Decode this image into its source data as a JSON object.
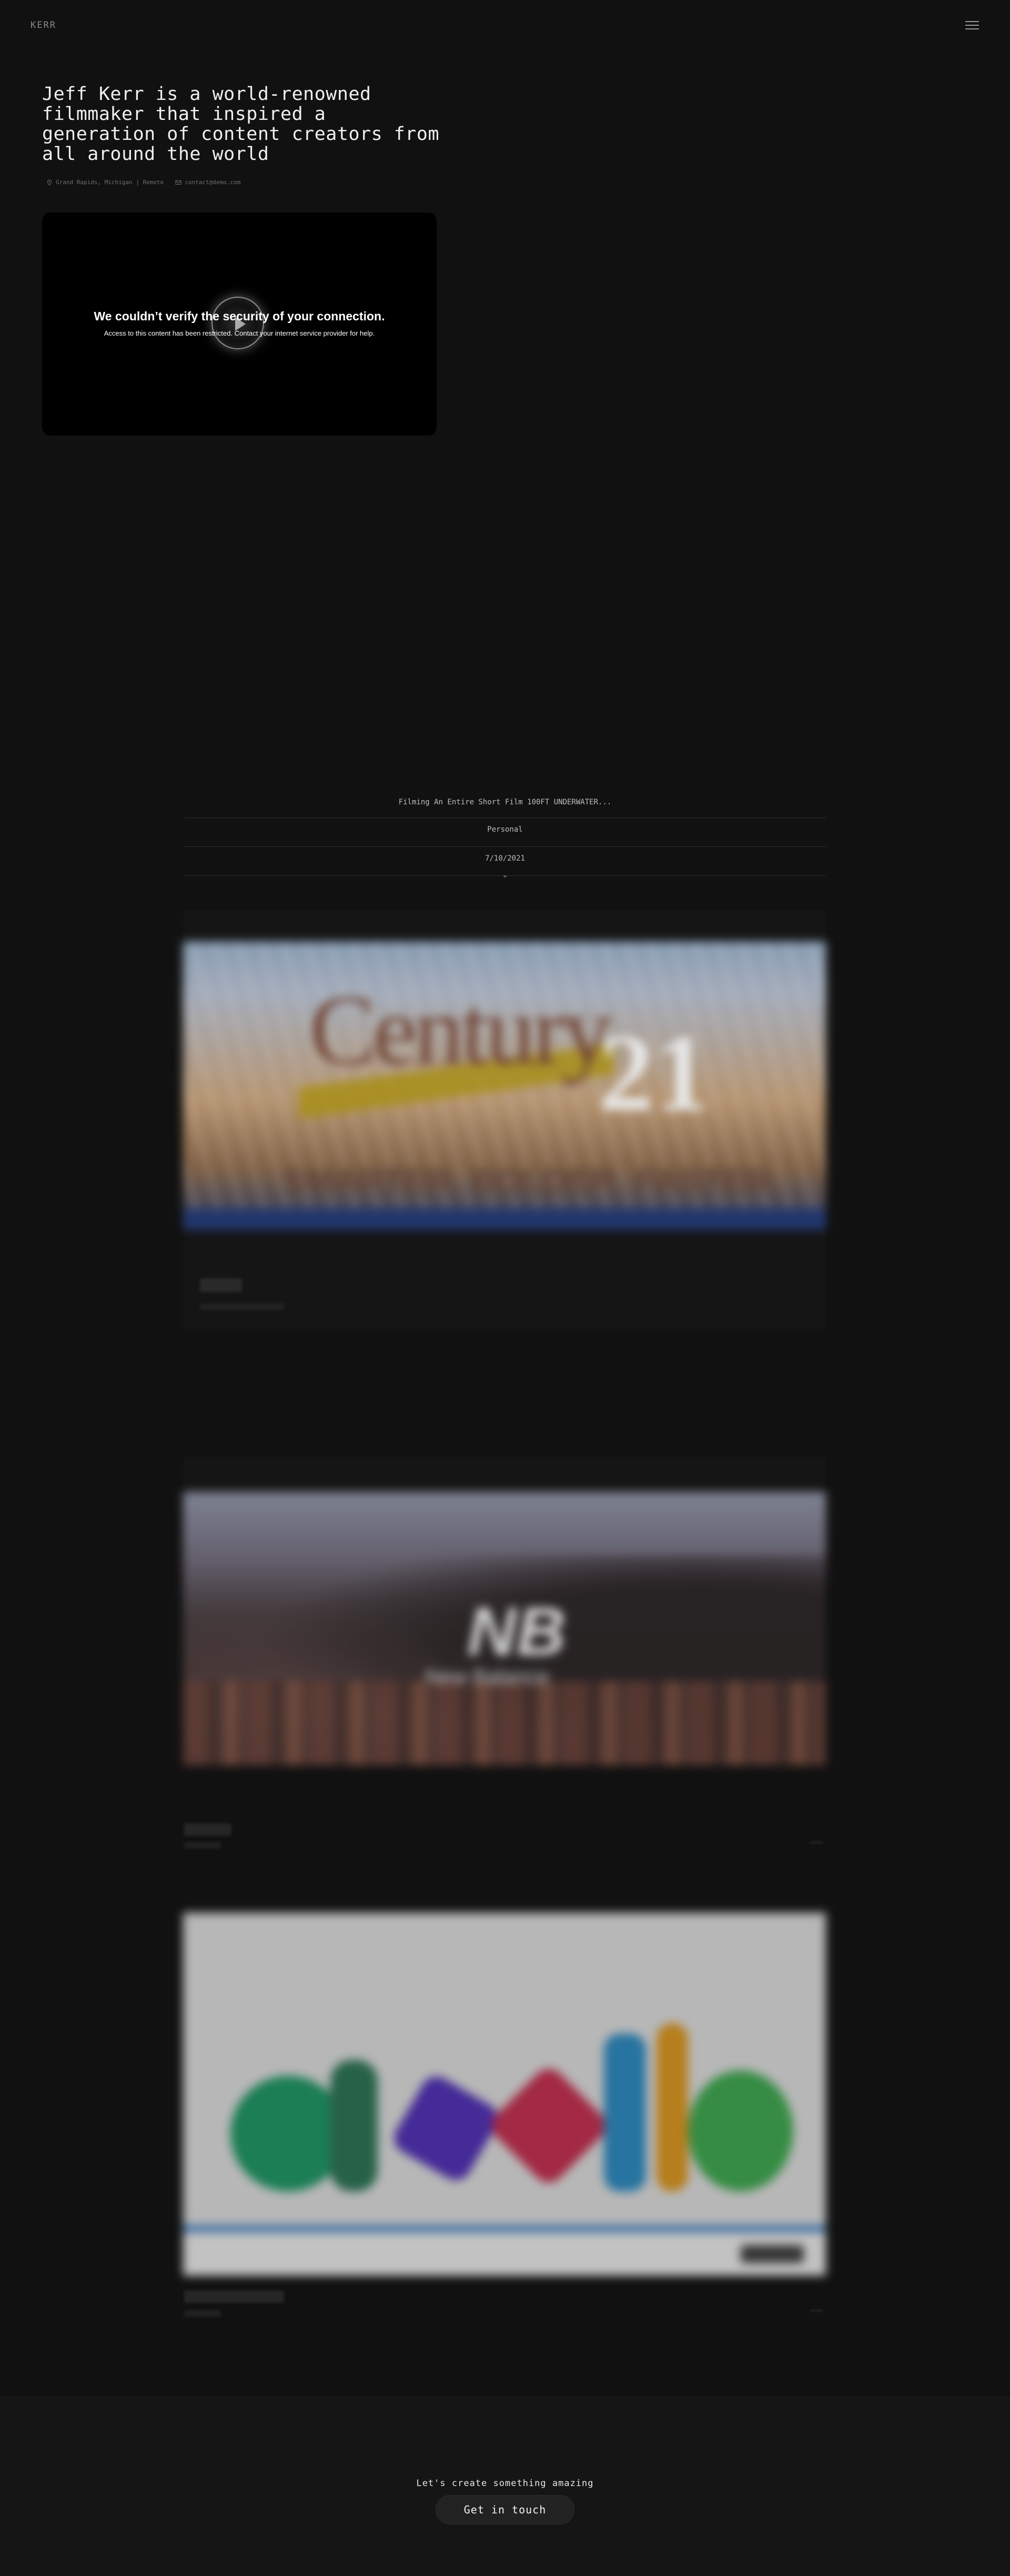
{
  "header": {
    "logo": "KERR",
    "menu_icon": "hamburger-menu-icon"
  },
  "hero": {
    "title": "Jeff Kerr is a world-renowned filmmaker that inspired a generation of content creators from all around the world",
    "location": "Grand Rapids, Michigan | Remote",
    "email": "contact@demo.com",
    "location_icon": "pin-icon",
    "email_icon": "envelope-icon"
  },
  "video": {
    "error_title": "We couldn’t verify the security of your connection.",
    "error_message": "Access to this content has been restricted. Contact your internet service provider for help.",
    "play_icon": "play-icon"
  },
  "project": {
    "title": "Filming An Entire Short Film 100FT UNDERWATER...",
    "category": "Personal",
    "date": "7/10/2021"
  },
  "cards": {
    "century21_brand": "Century",
    "century21_number": "21",
    "century21_tagline": "SMARTER. BOLDER. FASTER.",
    "nb_logo": "NB",
    "nb_sub": "New Balance"
  },
  "footer": {
    "tagline": "Let's create something amazing",
    "cta": "Get in touch"
  },
  "colors": {
    "background": "#111111",
    "footer_background": "#151515",
    "text": "#e8e8e8",
    "muted": "#6e6e6e"
  }
}
